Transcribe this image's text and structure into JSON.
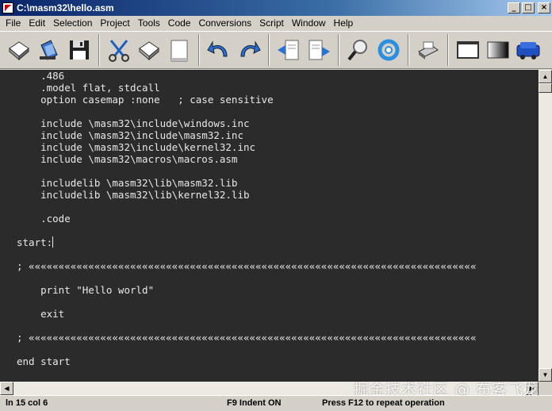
{
  "window": {
    "title": "C:\\masm32\\hello.asm",
    "buttons": {
      "minimize": "_",
      "maximize": "□",
      "close": "×"
    }
  },
  "menu": [
    "File",
    "Edit",
    "Selection",
    "Project",
    "Tools",
    "Code",
    "Conversions",
    "Script",
    "Window",
    "Help"
  ],
  "toolbar": [
    "new-file-icon",
    "open-file-icon",
    "save-icon",
    "cut-icon",
    "copy-icon",
    "paste-icon",
    "undo-icon",
    "redo-icon",
    "import-icon",
    "export-icon",
    "find-icon",
    "replace-icon",
    "print-icon",
    "window-icon",
    "fullscreen-icon",
    "run-icon"
  ],
  "code": [
    "    .486",
    "    .model flat, stdcall",
    "    option casemap :none   ; case sensitive",
    "",
    "    include \\masm32\\include\\windows.inc",
    "    include \\masm32\\include\\masm32.inc",
    "    include \\masm32\\include\\kernel32.inc",
    "    include \\masm32\\macros\\macros.asm",
    "",
    "    includelib \\masm32\\lib\\masm32.lib",
    "    includelib \\masm32\\lib\\kernel32.lib",
    "",
    "    .code",
    "",
    "start:",
    "",
    "; «««««««««««««««««««««««««««««««««««««««««««««««««««««««««««««««««««««««««««",
    "",
    "    print \"Hello world\"",
    "",
    "    exit",
    "",
    "; «««««««««««««««««««««««««««««««««««««««««««««««««««««««««««««««««««««««««««",
    "",
    "end start"
  ],
  "status": {
    "position": "ln 15 col 6",
    "indent": "F9 Indent ON",
    "hint": "Press F12 to repeat operation"
  },
  "watermark": "掘金技术社区 @ 布客飞龙"
}
